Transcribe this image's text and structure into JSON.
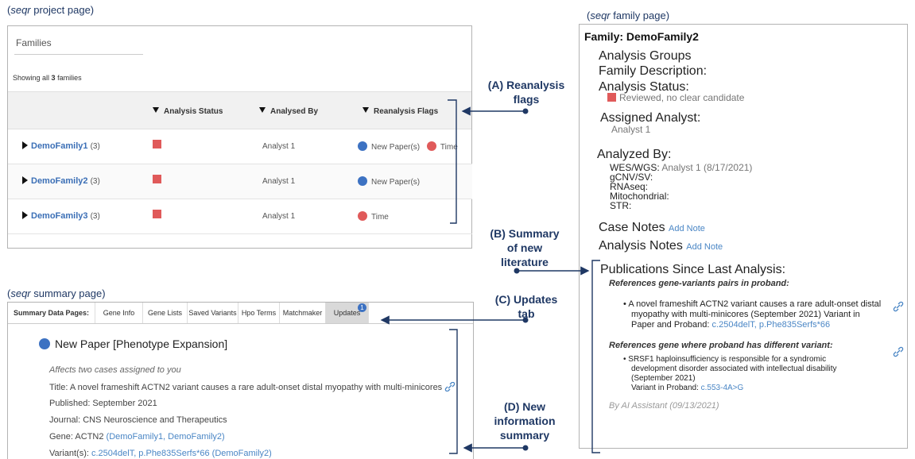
{
  "captions": {
    "project_prefix": "(",
    "project_app": "seqr",
    "project_suffix": " project page)",
    "summary_app": "seqr",
    "summary_suffix": " summary page)",
    "family_app": "seqr",
    "family_suffix": " family page)"
  },
  "project": {
    "header": "Families",
    "showing_prefix": "Showing all",
    "showing_count": "3",
    "showing_suffix": "families",
    "columns": {
      "status": "Analysis Status",
      "by": "Analysed By",
      "flags": "Reanalysis Flags"
    },
    "rows": [
      {
        "name": "DemoFamily1",
        "count": "(3)",
        "by": "Analyst 1",
        "flag1": "New Paper(s)",
        "flag2": "Time"
      },
      {
        "name": "DemoFamily2",
        "count": "(3)",
        "by": "Analyst 1",
        "flag1": "New Paper(s)"
      },
      {
        "name": "DemoFamily3",
        "count": "(3)",
        "by": "Analyst 1",
        "flag2": "Time"
      }
    ]
  },
  "annotations": {
    "a1": "(A) Reanalysis",
    "a2": "flags",
    "b1": "(B) Summary",
    "b2": "of new",
    "b3": "literature",
    "c1": "(C) Updates",
    "c2": "tab",
    "d1": "(D) New",
    "d2": "information",
    "d3": "summary"
  },
  "summary": {
    "label": "Summary Data Pages:",
    "tabs": [
      "Gene Info",
      "Gene Lists",
      "Saved Variants",
      "Hpo Terms",
      "Matchmaker",
      "Updates"
    ],
    "updates_badge": "1",
    "paper_title": "New Paper [Phenotype Expansion]",
    "affects": "Affects two cases assigned to you",
    "title_line": "Title: A novel frameshift ACTN2 variant causes a rare adult-onset distal myopathy with multi-minicores",
    "published": "Published: September 2021",
    "journal": "Journal: CNS Neuroscience and Therapeutics",
    "gene_prefix": "Gene: ACTN2",
    "gene_link": "(DemoFamily1, DemoFamily2)",
    "variant_prefix": "Variant(s):",
    "variant_link": "c.2504delT, p.Phe835Serfs*66",
    "variant_family": "(DemoFamily2)"
  },
  "family": {
    "title": "Family: DemoFamily2",
    "analysis_groups": "Analysis Groups",
    "family_description": "Family Description:",
    "analysis_status_label": "Analysis Status:",
    "analysis_status_value": "Reviewed, no clear candidate",
    "assigned_label": "Assigned Analyst:",
    "assigned_value": "Analyst 1",
    "analyzed_by_label": "Analyzed By:",
    "wes_label": "WES/WGS:",
    "wes_value": "Analyst 1 (8/17/2021)",
    "gcnv": "gCNV/SV:",
    "rnaseq": "RNAseq:",
    "mito": "Mitochondrial:",
    "str": "STR:",
    "case_notes": "Case Notes",
    "add_note": "Add Note",
    "analysis_notes": "Analysis Notes",
    "pubs_label": "Publications Since Last Analysis:",
    "ref1_label": "References gene-variants pairs in proband:",
    "ref1_text_1": "A novel frameshift ACTN2 variant causes a rare adult-onset distal",
    "ref1_text_2": "myopathy with multi-minicores (September 2021) Variant in",
    "ref1_text_3": "Paper and Proband:",
    "ref1_link": "c.2504delT, p.Phe835Serfs*66",
    "ref2_label": "References gene where proband has different variant:",
    "ref2_text_1": "SRSF1 haploinsufficiency is responsible for a syndromic",
    "ref2_text_2": "development disorder associated with intellectual disability",
    "ref2_text_3": "(September 2021)",
    "ref2_text_4": "Variant in Proband:",
    "ref2_link": "c.553-4A>G",
    "assistant": "By AI Assistant (09/13/2021)"
  },
  "colors": {
    "accent": "#1f3864",
    "link": "#4a86c5",
    "status_red": "#e05a5a",
    "dot_blue": "#3d72c2"
  }
}
